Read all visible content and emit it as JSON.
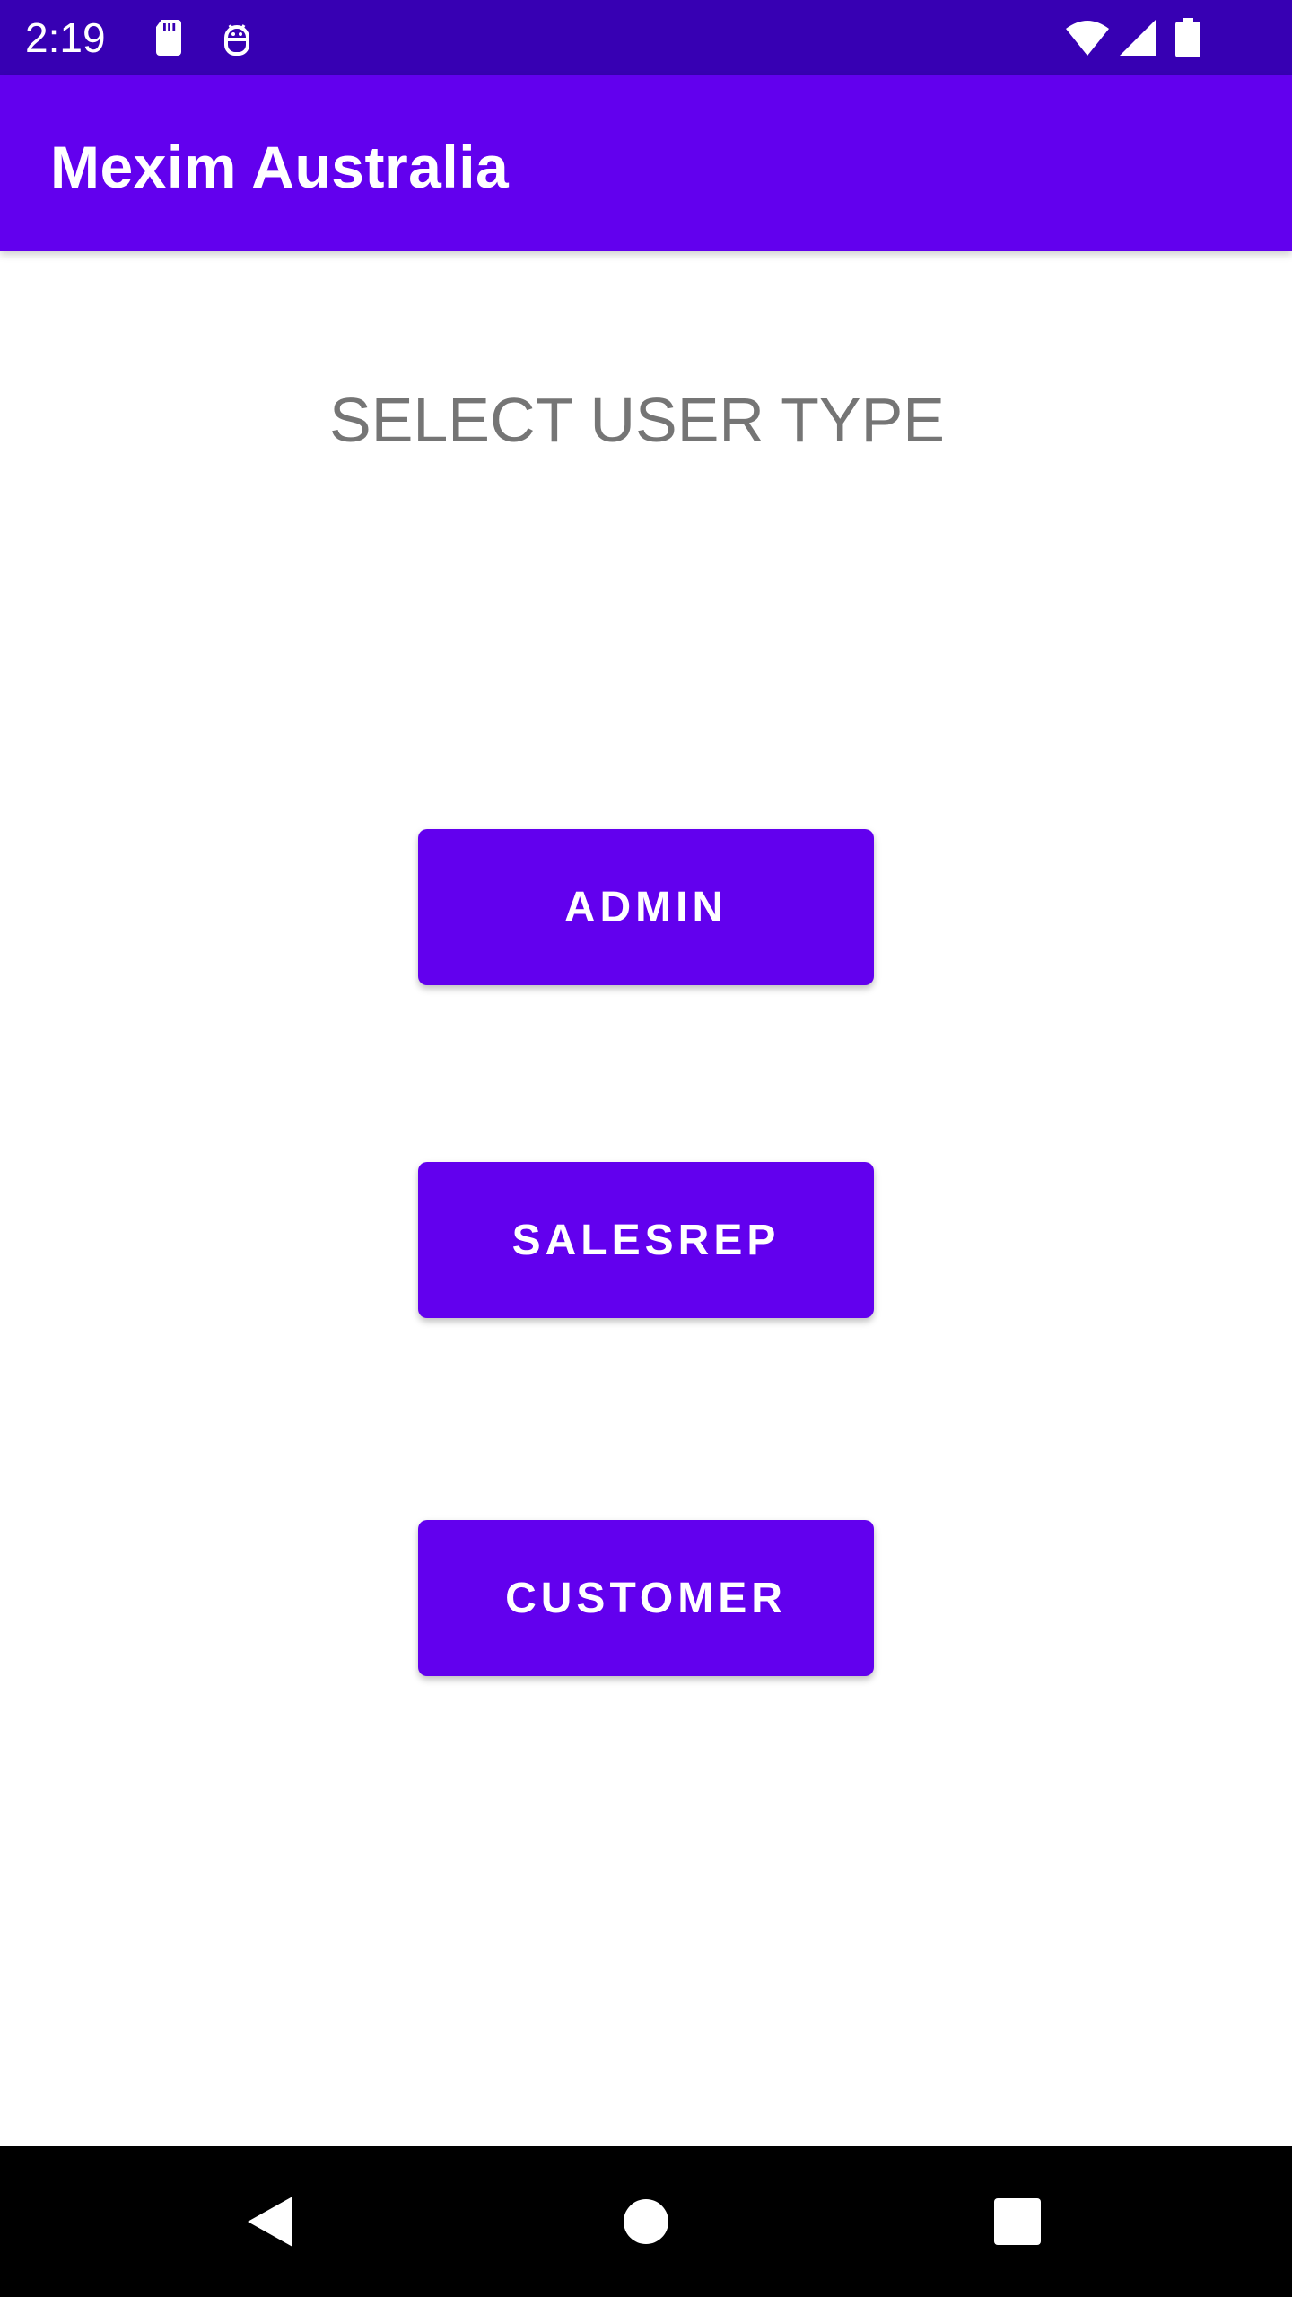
{
  "status_bar": {
    "time": "2:19",
    "icons": [
      "sd-card-icon",
      "android-debug-icon",
      "wifi-icon",
      "signal-icon",
      "battery-icon"
    ]
  },
  "app_bar": {
    "title": "Mexim Australia",
    "color": "#6200EE"
  },
  "main": {
    "heading": "SELECT USER TYPE",
    "buttons": [
      {
        "label": "ADMIN"
      },
      {
        "label": "SALESREP"
      },
      {
        "label": "CUSTOMER"
      }
    ]
  },
  "nav_bar": {
    "icons": [
      "back-icon",
      "home-icon",
      "recents-icon"
    ]
  },
  "colors": {
    "status_bar": "#3700B3",
    "primary": "#6200EE",
    "heading_text": "#757575"
  }
}
